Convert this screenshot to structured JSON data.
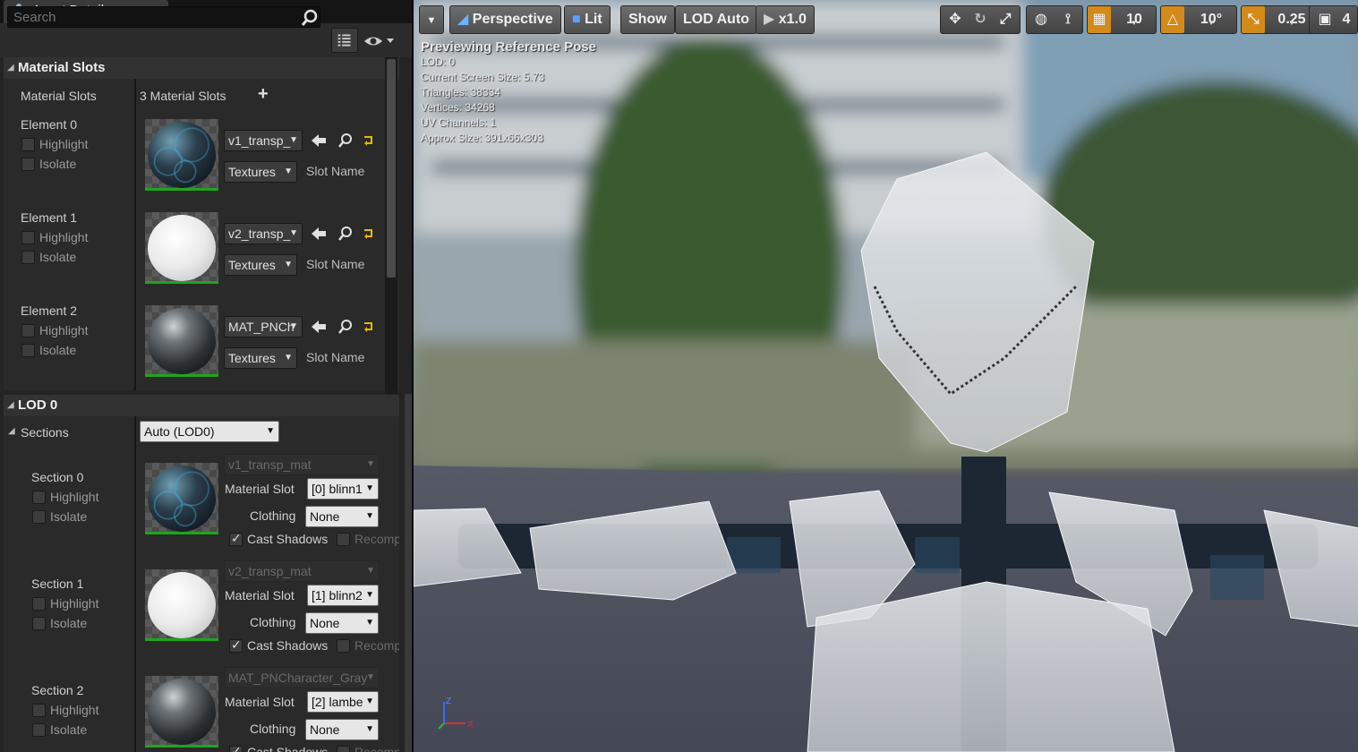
{
  "panel": {
    "tab_title": "Asset Details",
    "tab_close": "×",
    "search_placeholder": "Search"
  },
  "material_slots": {
    "header": "Material Slots",
    "row_label": "Material Slots",
    "count_text": "3 Material Slots",
    "add_symbol": "+",
    "elements": [
      {
        "label": "Element 0",
        "highlight": "Highlight",
        "isolate": "Isolate",
        "material": "v1_transp_",
        "textures": "Textures",
        "slot_name": "Slot Name",
        "thumb": "blue"
      },
      {
        "label": "Element 1",
        "highlight": "Highlight",
        "isolate": "Isolate",
        "material": "v2_transp_",
        "textures": "Textures",
        "slot_name": "Slot Name",
        "thumb": "white"
      },
      {
        "label": "Element 2",
        "highlight": "Highlight",
        "isolate": "Isolate",
        "material": "MAT_PNCh",
        "textures": "Textures",
        "slot_name": "Slot Name",
        "thumb": "grey"
      }
    ]
  },
  "lod0": {
    "header": "LOD 0",
    "sections_label": "Sections",
    "lod_select": "Auto (LOD0)",
    "sections": [
      {
        "label": "Section 0",
        "highlight": "Highlight",
        "isolate": "Isolate",
        "material": "v1_transp_mat",
        "material_slot_label": "Material Slot",
        "material_slot_value": "[0] blinn1",
        "clothing_label": "Clothing",
        "clothing_value": "None",
        "cast_shadows": "Cast Shadows",
        "cast_shadows_checked": true,
        "recompute": "Recomp",
        "thumb": "blue"
      },
      {
        "label": "Section 1",
        "highlight": "Highlight",
        "isolate": "Isolate",
        "material": "v2_transp_mat",
        "material_slot_label": "Material Slot",
        "material_slot_value": "[1] blinn2",
        "clothing_label": "Clothing",
        "clothing_value": "None",
        "cast_shadows": "Cast Shadows",
        "cast_shadows_checked": true,
        "recompute": "Recomp",
        "thumb": "white"
      },
      {
        "label": "Section 2",
        "highlight": "Highlight",
        "isolate": "Isolate",
        "material": "MAT_PNCharacter_Gray",
        "material_slot_label": "Material Slot",
        "material_slot_value": "[2] lambe",
        "clothing_label": "Clothing",
        "clothing_value": "None",
        "cast_shadows": "Cast Shadows",
        "cast_shadows_checked": true,
        "recompute": "Recomp",
        "thumb": "grey"
      }
    ]
  },
  "viewport": {
    "toolbar": {
      "perspective": "Perspective",
      "lit": "Lit",
      "show": "Show",
      "lod": "LOD Auto",
      "speed": "x1.0",
      "grid_snap": "10",
      "rotation_snap": "10°",
      "scale_snap": "0.25",
      "camera_speed": "4"
    },
    "stats": {
      "title": "Previewing Reference Pose",
      "lines": [
        "LOD: 0",
        "Current Screen Size: 5.73",
        "Triangles: 38334",
        "Vertices: 34268",
        "UV Channels: 1",
        "Approx Size: 391x66x303"
      ]
    },
    "axes": {
      "x": "X",
      "z": "Z"
    }
  },
  "colors": {
    "accent_orange": "#d38a18",
    "thumb_green": "#1ea51e",
    "panel_bg": "#242424"
  }
}
